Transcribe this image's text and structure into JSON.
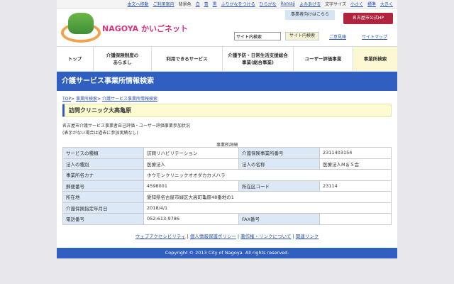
{
  "topbar": {
    "skip": "本文へ移動",
    "guide": "ご利用案内",
    "bg_label": "背景色",
    "bg_white": "白",
    "bg_blue": "青",
    "bg_black": "黒",
    "furigana": "ふりがなをつける",
    "hiragana": "ひらがな",
    "romaji": "Romaji",
    "read": "よみあげる",
    "fontsize_label": "文字サイズ",
    "small": "小さく",
    "standard": "標準",
    "large": "大きく"
  },
  "header": {
    "site_name": "NAGOYA かいごネット",
    "business": "事業者向けはこちら",
    "city_hp": "名古屋市公式HP",
    "search_placeholder": "サイト内検索",
    "search_button": "サイト内検索",
    "feedback": "ご意見箱",
    "sitemap": "サイトマップ"
  },
  "nav": [
    {
      "label": "トップ"
    },
    {
      "label": "介護保険制度の\nあらまし"
    },
    {
      "label": "利用できるサービス"
    },
    {
      "label": "介護予防・日常生活支援総合\n事業(総合事業)"
    },
    {
      "label": "ユーザー評価事業"
    },
    {
      "label": "事業所検索"
    }
  ],
  "page_title": "介護サービス事業所情報検索",
  "breadcrumb": {
    "top": "TOP",
    "sep": ">",
    "search": "事業所検索",
    "current": "介護サービス事業所情報検索"
  },
  "facility_name": "訪問クリニック大高亀原",
  "note": {
    "line1": "名古屋市介護サービス事業者自己評価・ユーザー評価事業参加状況",
    "line2": "(表示がない場合は過去に参加実績なし)"
  },
  "table": {
    "caption": "事業所詳細",
    "service_type_label": "サービスの種類",
    "service_type": "訪問リハビリテーション",
    "office_no_label": "介護保険事業所番号",
    "office_no": "2311403154",
    "corp_type_label": "法人の種別",
    "corp_type": "医療法人",
    "corp_name_label": "法人の名称",
    "corp_name": "医療法人M＆Ｓ会",
    "kana_label": "事業所名カナ",
    "kana": "ホウモンクリニックオオダカカメハラ",
    "zip_label": "郵便番号",
    "zip": "4598001",
    "ward_label": "所在区コード",
    "ward": "23114",
    "address_label": "所在地",
    "address": "愛知県名古屋市緑区大高町亀原48番地の1",
    "date_label": "介護保険指定年月日",
    "date": "2018/4/1",
    "tel_label": "電話番号",
    "tel": "052-613-9786",
    "fax_label": "FAX番号",
    "fax": ""
  },
  "footer": {
    "links": [
      "ウェブアクセシビリティ",
      "個人情報保護ポリシー",
      "著作権・リンクについて",
      "関連リンク"
    ],
    "copyright": "Copyright © 2013 City of Nagoya. All rights reserved."
  }
}
